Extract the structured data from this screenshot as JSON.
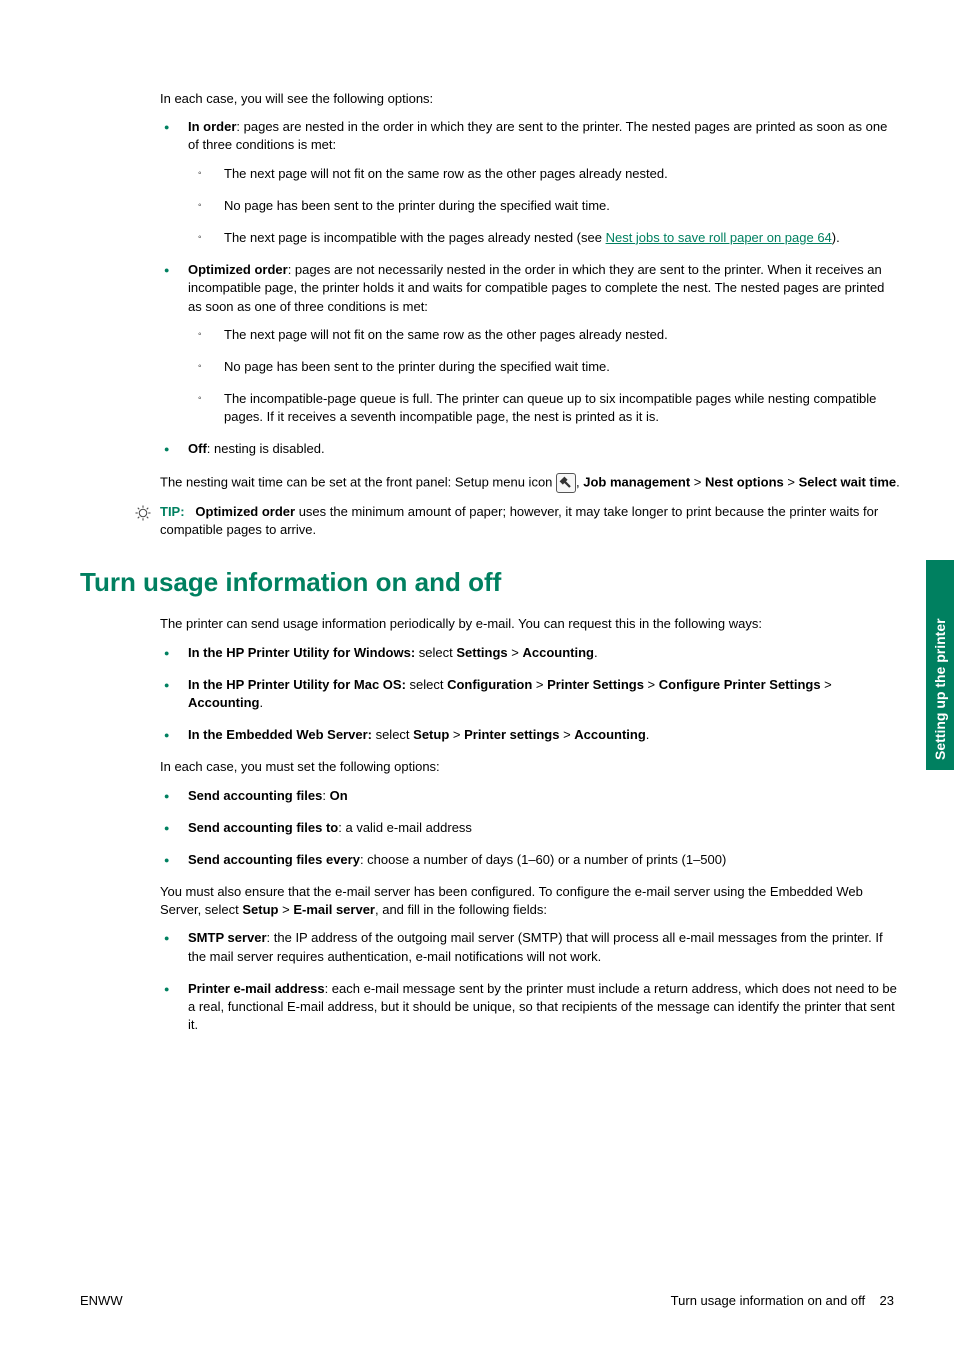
{
  "intro": "In each case, you will see the following options:",
  "b1": [
    {
      "lead_label": "In order",
      "lead_rest": ": pages are nested in the order in which they are sent to the printer. The nested pages are printed as soon as one of three conditions is met:",
      "sub": [
        {
          "text": "The next page will not fit on the same row as the other pages already nested."
        },
        {
          "text": "No page has been sent to the printer during the specified wait time."
        },
        {
          "text_before": "The next page is incompatible with the pages already nested (see ",
          "link": "Nest jobs to save roll paper on page 64",
          "text_after": ")."
        }
      ]
    },
    {
      "lead_label": "Optimized order",
      "lead_rest": ": pages are not necessarily nested in the order in which they are sent to the printer. When it receives an incompatible page, the printer holds it and waits for compatible pages to complete the nest. The nested pages are printed as soon as one of three conditions is met:",
      "sub": [
        {
          "text": "The next page will not fit on the same row as the other pages already nested."
        },
        {
          "text": "No page has been sent to the printer during the specified wait time."
        },
        {
          "text": "The incompatible-page queue is full. The printer can queue up to six incompatible pages while nesting compatible pages. If it receives a seventh incompatible page, the nest is printed as it is."
        }
      ]
    },
    {
      "lead_label": "Off",
      "lead_rest": ": nesting is disabled."
    }
  ],
  "nesting_line_a": "The nesting wait time can be set at the front panel: Setup menu icon",
  "nesting_line_b_before": ", ",
  "nesting_line_b_b1": "Job management",
  "nesting_line_b_sep": " > ",
  "nesting_line_b_b2": "Nest options",
  "nesting_line_b_sep2": " > ",
  "nesting_line_b_b3": "Select wait time",
  "nesting_line_b_end": ".",
  "tip_label": "TIP:",
  "tip_bold": "Optimized order",
  "tip_rest": " uses the minimum amount of paper; however, it may take longer to print because the printer waits for compatible pages to arrive.",
  "section2": "Turn usage information on and off",
  "s2_intro": "The printer can send usage information periodically by e-mail. You can request this in the following ways:",
  "s2_list": [
    {
      "parts": [
        {
          "b": "In the HP Printer Utility for Windows:"
        },
        {
          "t": " select "
        },
        {
          "b": "Settings"
        },
        {
          "t": " > "
        },
        {
          "b": "Accounting"
        },
        {
          "t": "."
        }
      ]
    },
    {
      "parts": [
        {
          "b": "In the HP Printer Utility for Mac OS:"
        },
        {
          "t": " select "
        },
        {
          "b": "Configuration"
        },
        {
          "t": " > "
        },
        {
          "b": "Printer Settings"
        },
        {
          "t": " > "
        },
        {
          "b": "Configure Printer Settings"
        },
        {
          "t": " > "
        },
        {
          "b": "Accounting"
        },
        {
          "t": "."
        }
      ]
    },
    {
      "parts": [
        {
          "b": "In the Embedded Web Server:"
        },
        {
          "t": " select "
        },
        {
          "b": "Setup"
        },
        {
          "t": " > "
        },
        {
          "b": "Printer settings"
        },
        {
          "t": " > "
        },
        {
          "b": "Accounting"
        },
        {
          "t": "."
        }
      ]
    }
  ],
  "s2_mid": "In each case, you must set the following options:",
  "s2_list2": [
    {
      "parts": [
        {
          "b": "Send accounting files"
        },
        {
          "t": ": "
        },
        {
          "b": "On"
        }
      ]
    },
    {
      "parts": [
        {
          "b": "Send accounting files to"
        },
        {
          "t": ": a valid e-mail address"
        }
      ]
    },
    {
      "parts": [
        {
          "b": "Send accounting files every"
        },
        {
          "t": ": choose a number of days (1–60) or a number of prints (1–500)"
        }
      ]
    }
  ],
  "s2_p_before": "You must also ensure that the e-mail server has been configured. To configure the e-mail server using the Embedded Web Server, select ",
  "s2_p_b1": "Setup",
  "s2_p_sep": " > ",
  "s2_p_b2": "E-mail server",
  "s2_p_after": ", and fill in the following fields:",
  "s2_list3": [
    {
      "parts": [
        {
          "b": "SMTP server"
        },
        {
          "t": ": the IP address of the outgoing mail server (SMTP) that will process all e-mail messages from the printer. If the mail server requires authentication, e-mail notifications will not work."
        }
      ]
    },
    {
      "parts": [
        {
          "b": "Printer e-mail address"
        },
        {
          "t": ": each e-mail message sent by the printer must include a return address, which does not need to be a real, functional E-mail address, but it should be unique, so that recipients of the message can identify the printer that sent it."
        }
      ]
    }
  ],
  "side_tab": "Setting up the printer",
  "footer_left": "ENWW",
  "footer_right_text": "Turn usage information on and off",
  "footer_right_page": "23"
}
